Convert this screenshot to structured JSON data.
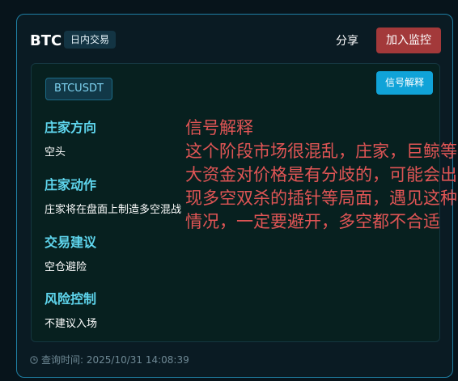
{
  "header": {
    "symbol": "BTC",
    "tag": "日内交易",
    "share_label": "分享",
    "watch_label": "加入监控"
  },
  "panel": {
    "pair": "BTCUSDT",
    "explain_label": "信号解释",
    "sections": [
      {
        "title": "庄家方向",
        "value": "空头"
      },
      {
        "title": "庄家动作",
        "value": "庄家将在盘面上制造多空混战"
      },
      {
        "title": "交易建议",
        "value": "空仓避险"
      },
      {
        "title": "风险控制",
        "value": "不建议入场"
      }
    ]
  },
  "overlay": {
    "title": "信号解释",
    "text": "这个阶段市场很混乱，庄家，巨鲸等大资金对价格是有分歧的，可能会出现多空双杀的插针等局面，遇见这种情况，一定要避开，多空都不合适"
  },
  "footer": {
    "query_time": "查询时间: 2025/10/31 14:08:39"
  },
  "colors": {
    "accent_cyan": "#5fd6ee",
    "button_red": "#a3393a",
    "button_blue": "#10a3d8",
    "overlay_red": "#e05555"
  },
  "icons": {
    "footer": "clock-icon"
  }
}
